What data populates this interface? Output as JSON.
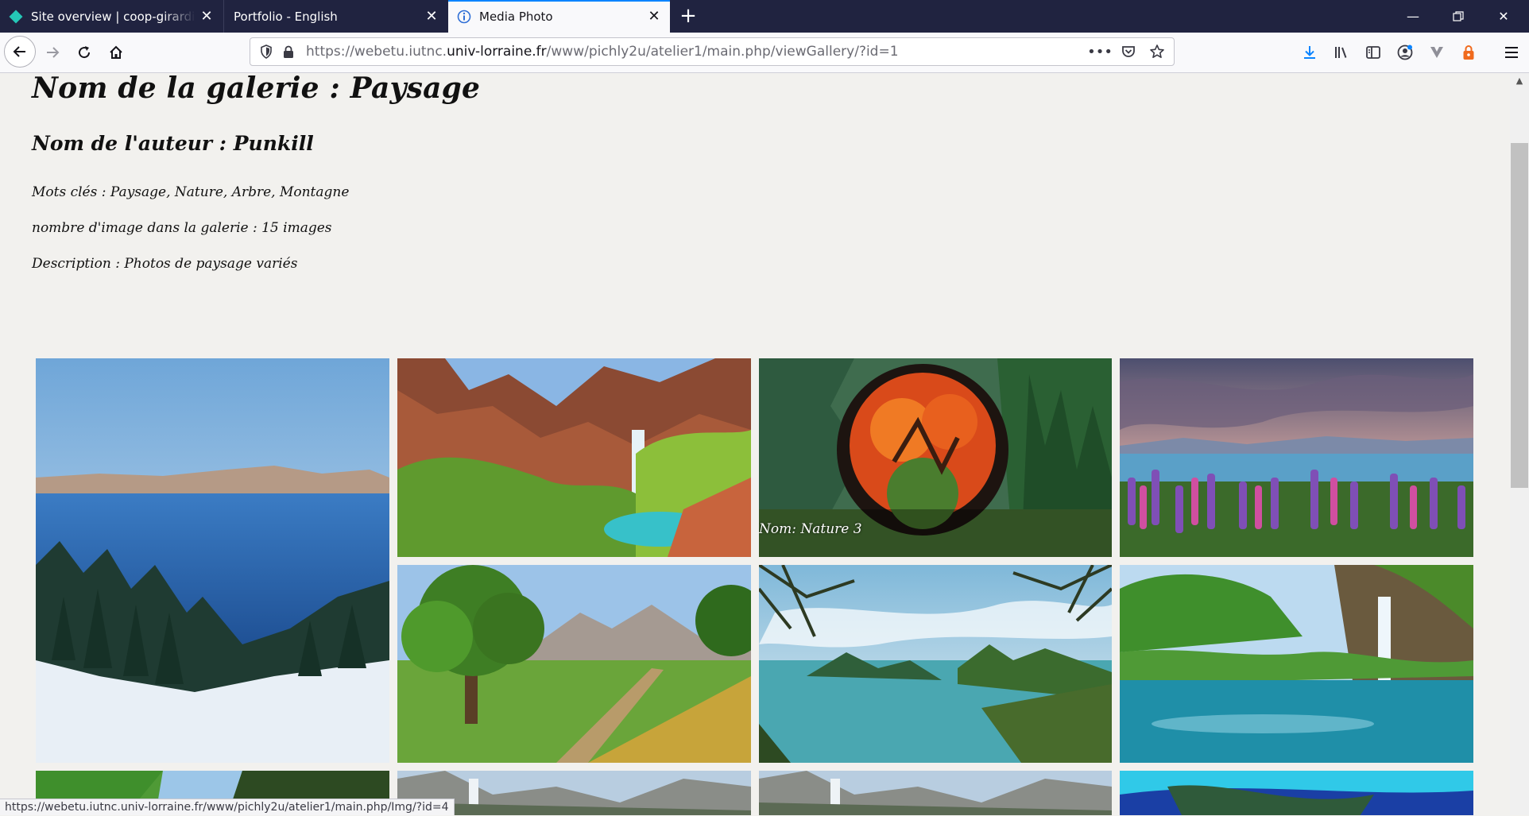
{
  "browser": {
    "tabs": [
      {
        "title": "Site overview | coop-girardinvil",
        "active": false
      },
      {
        "title": "Portfolio - English",
        "active": false
      },
      {
        "title": "Media Photo",
        "active": true
      }
    ],
    "url": {
      "prefix": "https://webetu.iutnc.",
      "host": "univ-lorraine.fr",
      "path": "/www/pichly2u/atelier1/main.php/viewGallery/?id=1"
    },
    "status_url": "https://webetu.iutnc.univ-lorraine.fr/www/pichly2u/atelier1/main.php/Img/?id=4",
    "accent_color": "#0a84ff"
  },
  "gallery": {
    "title": "Nom de la galerie : Paysage",
    "author": "Nom de l'auteur : Punkill",
    "keywords": "Mots clés : Paysage, Nature, Arbre, Montagne",
    "image_count": "nombre d'image dans la galerie : 15 images",
    "description": "Description : Photos de paysage variés",
    "hover_caption": "Nom: Nature 3"
  }
}
